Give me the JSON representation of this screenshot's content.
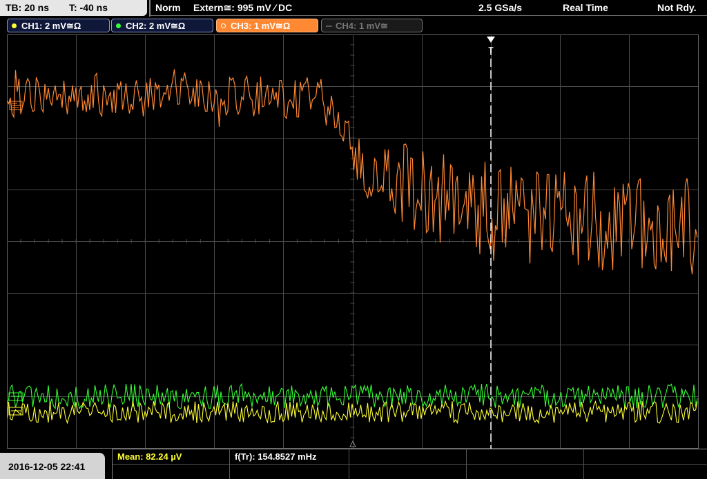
{
  "header": {
    "timebase": "TB: 20 ns",
    "trigger_time": "T: -40 ns",
    "trigger_mode": "Norm",
    "trigger_source": "Extern≅: 995 mV ⁄ DC",
    "sample_rate": "2.5 GSa/s",
    "acquisition_mode": "Real Time",
    "status": "Not Rdy."
  },
  "channels": [
    {
      "label": "CH1: 2 mV≅Ω",
      "color": "#ffff33",
      "active": true
    },
    {
      "label": "CH2: 2 mV≅Ω",
      "color": "#33ff33",
      "active": true
    },
    {
      "label": "CH3: 1 mV≅Ω",
      "color": "#ff9933",
      "active": true,
      "selected": true
    },
    {
      "label": "CH4: 1 mV≅",
      "color": "#777777",
      "active": false
    }
  ],
  "trigger_marker": "T",
  "footer": {
    "date": "2016-12-05 22:41",
    "mean": "Mean: 82.24 µV",
    "freq": "f(Tr): 154.8527 mHz"
  },
  "colors": {
    "grid": "#4a4a4a",
    "ch1": "#ffff33",
    "ch2": "#33ff33",
    "ch3": "#ff9933"
  }
}
